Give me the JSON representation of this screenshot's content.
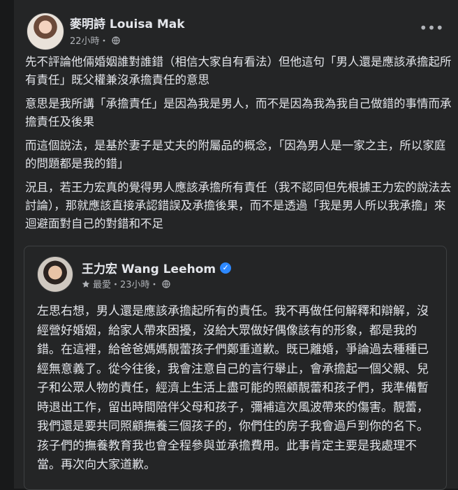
{
  "post": {
    "author": "麥明詩 Louisa Mak",
    "time": "22小時・",
    "more_icon": "more-horizontal-icon",
    "paragraphs": [
      "先不評論他倆婚姻誰對誰錯（相信大家自有看法）但他這句「男人還是應該承擔起所有責任」既父權兼沒承擔責任的意思",
      "意思是我所講「承擔責任」是因為我是男人，而不是因為我為我自己做錯的事情而承擔責任及後果",
      "而這個說法，是基於妻子是丈夫的附屬品的概念，「因為男人是一家之主，所以家庭的問題都是我的錯」",
      "況且，若王力宏真的覺得男人應該承擔所有責任（我不認同但先根據王力宏的說法去討論），那就應該直接承認錯誤及承擔後果，而不是透過「我是男人所以我承擔」來迴避面對自己的對錯和不足"
    ]
  },
  "shared": {
    "author": "王力宏 Wang Leehom",
    "meta_label": "最愛・23小時・",
    "text": "左思右想，男人還是應該承擔起所有的責任。我不再做任何解釋和辯解，沒經營好婚姻，給家人帶來困擾，沒給大眾做好偶像該有的形象，都是我的錯。在這裡，給爸爸媽媽靚蕾孩子們鄭重道歉。既已離婚，爭論過去種種已經無意義了。從今往後，我會注意自己的言行舉止，會承擔起一個父親、兒子和公眾人物的責任，經濟上生活上盡可能的照顧靚蕾和孩子們，我準備暫時退出工作，留出時間陪伴父母和孩子，彌補這次風波帶來的傷害。靚蕾，我們還是要共同照顧撫養三個孩子的，你們住的房子我會過戶到你的名下。孩子們的撫養教育我也會全程參與並承擔費用。此事肯定主要是我處理不當。再次向大家道歉。"
  },
  "colors": {
    "background": "#18191a",
    "card": "#242526",
    "text": "#e4e6eb",
    "secondary": "#b0b3b8",
    "verified": "#2d88ff"
  }
}
